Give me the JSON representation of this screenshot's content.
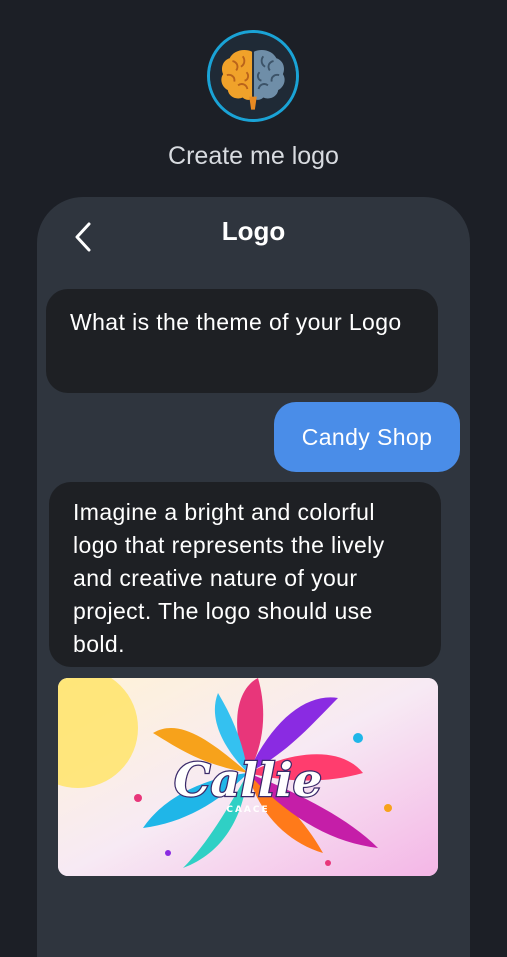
{
  "headline": "Create me logo",
  "chat": {
    "title": "Logo",
    "messages": [
      {
        "role": "bot",
        "text": "What is the theme of your Logo"
      },
      {
        "role": "user",
        "text": "Candy Shop"
      },
      {
        "role": "bot",
        "text": "Imagine a bright and colorful logo that represents the lively and creative nature of your project. The logo should use bold."
      }
    ],
    "image": {
      "wordmark": "Callie",
      "sub_text": "CAACE"
    }
  },
  "icons": {
    "app": "brain-icon",
    "back": "chevron-left-icon"
  },
  "colors": {
    "background": "#1c1f26",
    "panel": "#2f353e",
    "bot_bubble": "#1e2024",
    "user_bubble": "#4a8de8",
    "icon_ring": "#1aa3d6"
  }
}
